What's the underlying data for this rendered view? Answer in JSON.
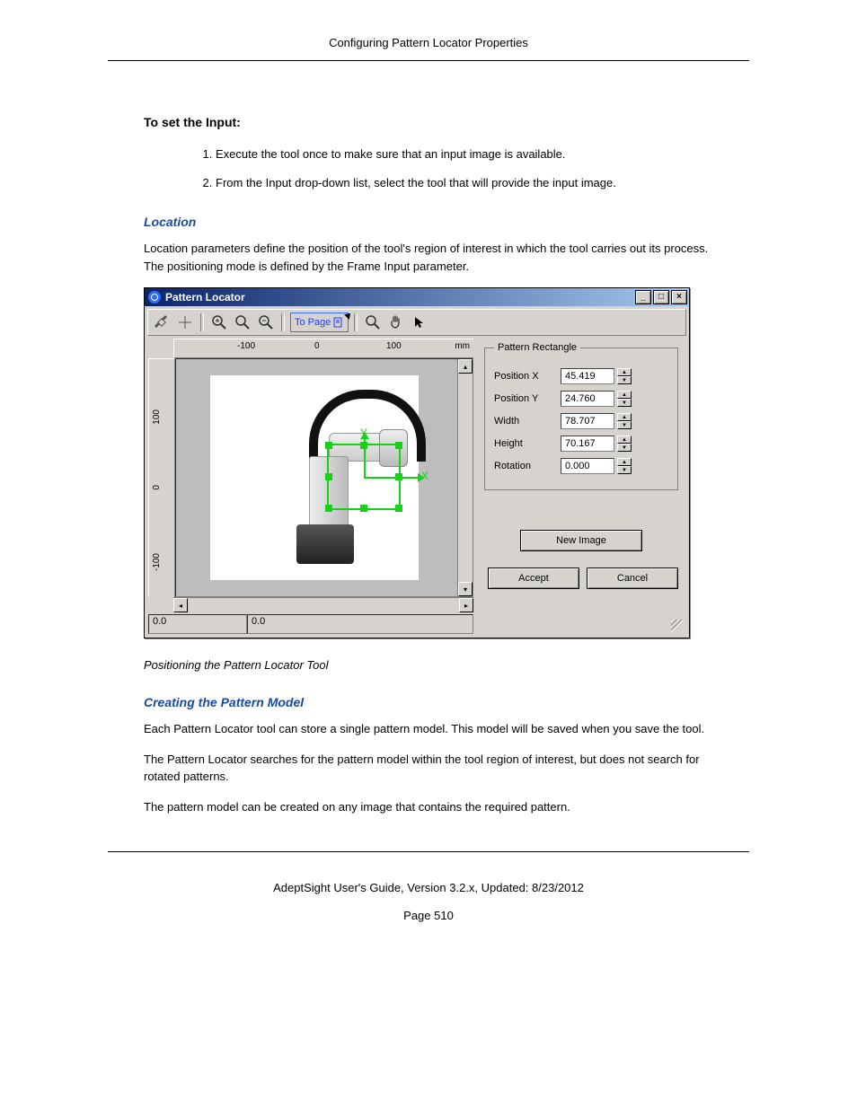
{
  "header": {
    "title": "Configuring Pattern Locator Properties"
  },
  "section_input": {
    "heading": "To set the Input:",
    "steps": [
      "Execute the tool once to make sure that an input image is available.",
      "From the Input drop-down list, select the tool that will provide the input image."
    ]
  },
  "section_location": {
    "heading": "Location",
    "body": "Location parameters define the position of the tool's region of interest in which the tool carries out its process. The positioning mode is defined by the Frame Input parameter."
  },
  "window": {
    "title": "Pattern Locator",
    "toolbar": {
      "topage_label": "To Page",
      "icons": {
        "tools": "tools-icon",
        "crosshair": "crosshair-icon",
        "zoom_in": "zoom-in-icon",
        "zoom_default": "zoom-icon",
        "zoom_out": "zoom-out-icon",
        "zoom_region": "zoom-region-icon",
        "pan": "pan-icon",
        "pointer": "pointer-icon"
      }
    },
    "ruler": {
      "h_ticks": [
        "-100",
        "0",
        "100"
      ],
      "h_unit": "mm",
      "v_ticks": [
        "100",
        "0",
        "-100"
      ]
    },
    "axis_labels": {
      "x": "X",
      "y": "Y"
    },
    "status": {
      "x": "0.0",
      "y": "0.0"
    },
    "panel": {
      "group_label": "Pattern Rectangle",
      "rows": [
        {
          "label": "Position X",
          "value": "45.419"
        },
        {
          "label": "Position Y",
          "value": "24.760"
        },
        {
          "label": "Width",
          "value": "78.707"
        },
        {
          "label": "Height",
          "value": "70.167"
        },
        {
          "label": "Rotation",
          "value": "0.000"
        }
      ],
      "new_image": "New Image",
      "accept": "Accept",
      "cancel": "Cancel"
    },
    "winbtns": {
      "min": "_",
      "max": "□",
      "close": "×"
    }
  },
  "caption": "Positioning the Pattern Locator Tool",
  "section_model": {
    "heading": "Creating the Pattern Model",
    "p1": "Each Pattern Locator tool can store a single pattern model. This model will be saved when you save the tool.",
    "p2": "The Pattern Locator searches for the pattern model within the tool region of interest, but does not search for rotated patterns.",
    "p3": "The pattern model can be created on any image that contains the required pattern."
  },
  "footer": {
    "line1": "AdeptSight User's Guide,  Version 3.2.x, Updated: 8/23/2012",
    "line2": "Page 510"
  }
}
